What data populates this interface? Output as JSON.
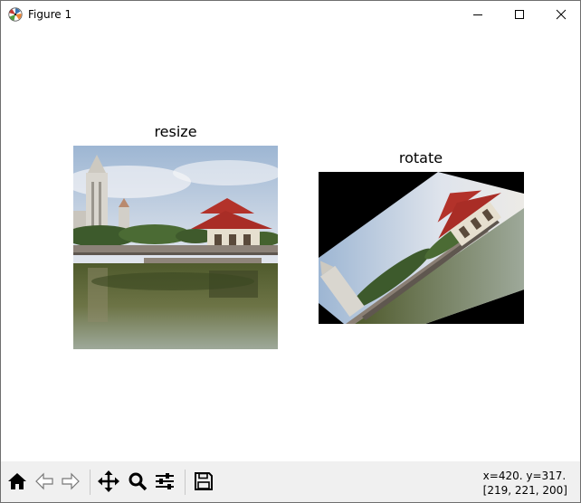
{
  "window": {
    "title": "Figure 1",
    "icon": "matplotlib-logo-icon",
    "controls": [
      "minimize-icon",
      "maximize-icon",
      "close-icon"
    ]
  },
  "figure": {
    "subplots": [
      {
        "title": "resize",
        "image": "pavilion-on-lake-photo"
      },
      {
        "title": "rotate",
        "image": "pavilion-on-lake-photo-rotated"
      }
    ]
  },
  "toolbar": {
    "buttons": [
      {
        "name": "home",
        "icon": "home-icon"
      },
      {
        "name": "back",
        "icon": "back-arrow-icon"
      },
      {
        "name": "forward",
        "icon": "forward-arrow-icon"
      },
      {
        "name": "pan",
        "icon": "move-arrows-icon"
      },
      {
        "name": "zoom",
        "icon": "magnifier-icon"
      },
      {
        "name": "configure-subplots",
        "icon": "sliders-icon"
      },
      {
        "name": "save",
        "icon": "floppy-disk-icon"
      }
    ],
    "coords_line1": "x=420. y=317.",
    "coords_line2": "[219, 221, 200]"
  },
  "colors": {
    "toolbar_bg": "#f0f0f0",
    "icon": "#000000",
    "rotate_background": "#000000"
  }
}
